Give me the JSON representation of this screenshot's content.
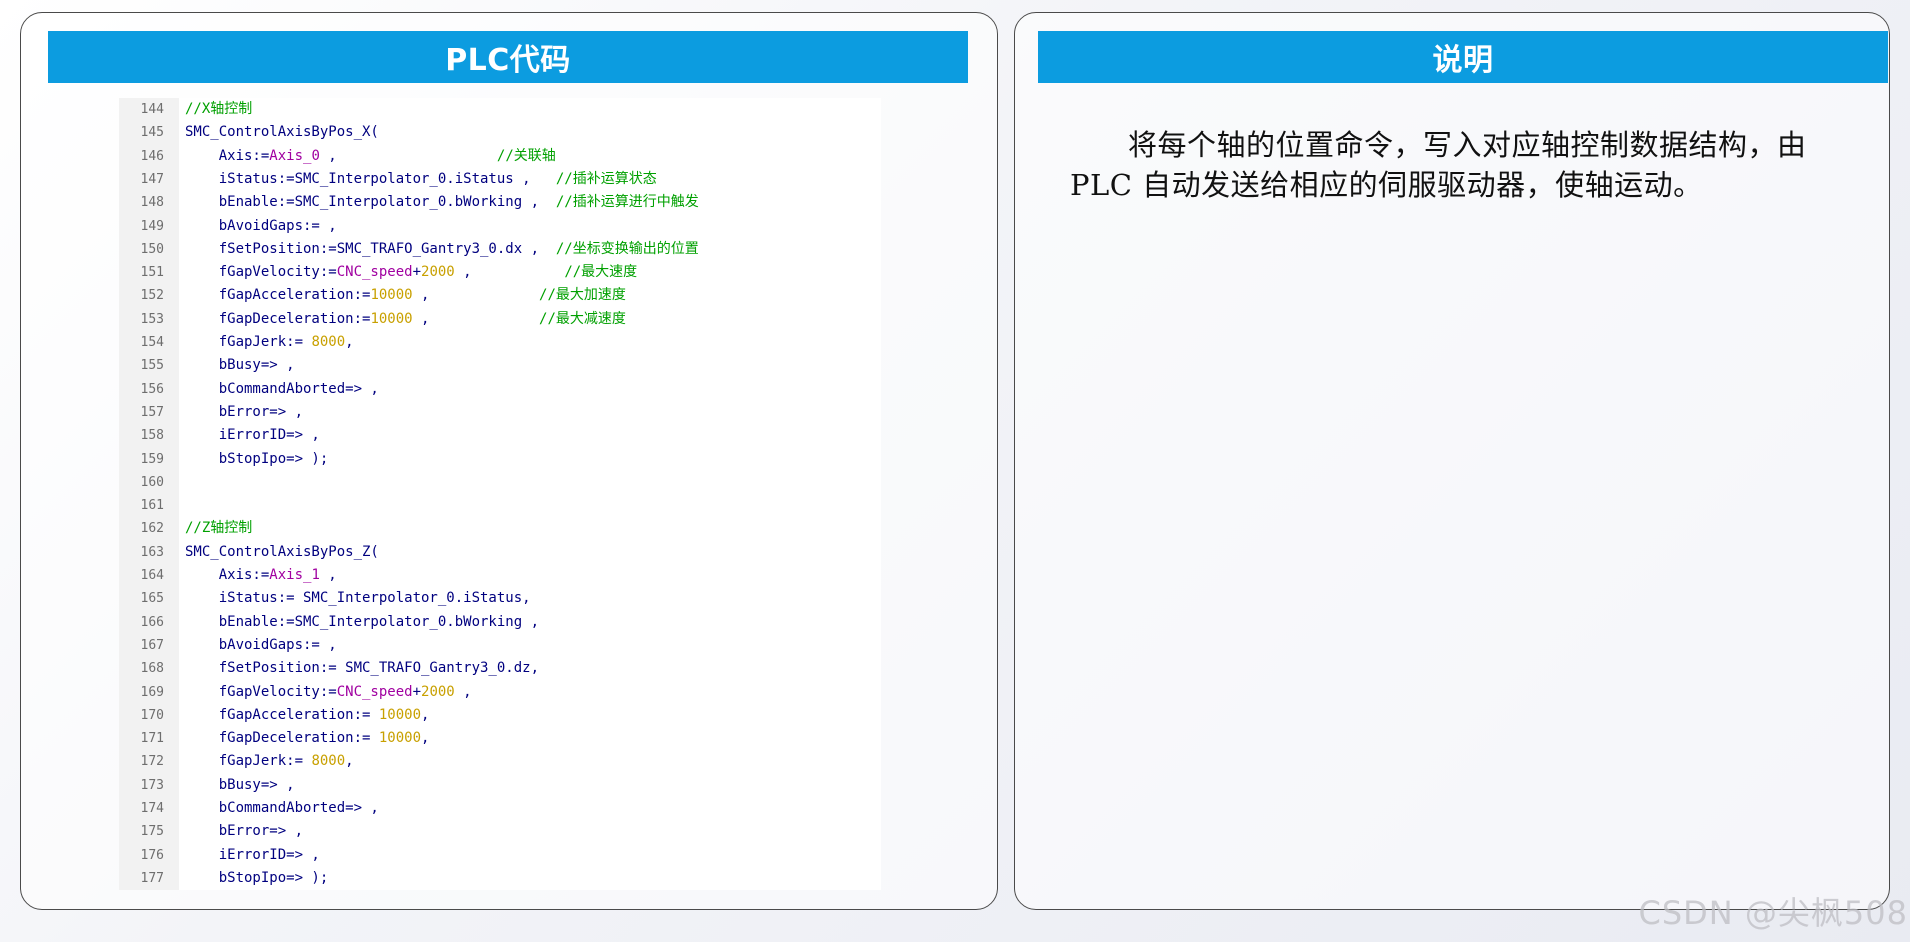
{
  "left_panel": {
    "title": "PLC代码",
    "code_lines": [
      {
        "num": "144",
        "parts": [
          {
            "t": "//X轴控制",
            "c": "green"
          }
        ]
      },
      {
        "num": "145",
        "parts": [
          {
            "t": "SMC_ControlAxisByPos_X(",
            "c": "blue"
          }
        ]
      },
      {
        "num": "146",
        "parts": [
          {
            "t": "    Axis:=",
            "c": "blue"
          },
          {
            "t": "Axis_0",
            "c": "purple"
          },
          {
            "t": " ,                   ",
            "c": "blue"
          },
          {
            "t": "//关联轴",
            "c": "green"
          }
        ]
      },
      {
        "num": "147",
        "parts": [
          {
            "t": "    iStatus:=SMC_Interpolator_0.iStatus ,   ",
            "c": "blue"
          },
          {
            "t": "//插补运算状态",
            "c": "green"
          }
        ]
      },
      {
        "num": "148",
        "parts": [
          {
            "t": "    bEnable:=SMC_Interpolator_0.bWorking ,  ",
            "c": "blue"
          },
          {
            "t": "//插补运算进行中触发",
            "c": "green"
          }
        ]
      },
      {
        "num": "149",
        "parts": [
          {
            "t": "    bAvoidGaps:= ,",
            "c": "blue"
          }
        ]
      },
      {
        "num": "150",
        "parts": [
          {
            "t": "    fSetPosition:=SMC_TRAFO_Gantry3_0.dx ,  ",
            "c": "blue"
          },
          {
            "t": "//坐标变换输出的位置",
            "c": "green"
          }
        ]
      },
      {
        "num": "151",
        "parts": [
          {
            "t": "    fGapVelocity:=",
            "c": "blue"
          },
          {
            "t": "CNC_speed",
            "c": "purple"
          },
          {
            "t": "+",
            "c": "blue"
          },
          {
            "t": "2000",
            "c": "orange"
          },
          {
            "t": " ,           ",
            "c": "blue"
          },
          {
            "t": "//最大速度",
            "c": "green"
          }
        ]
      },
      {
        "num": "152",
        "parts": [
          {
            "t": "    fGapAcceleration:=",
            "c": "blue"
          },
          {
            "t": "10000",
            "c": "orange"
          },
          {
            "t": " ,             ",
            "c": "blue"
          },
          {
            "t": "//最大加速度",
            "c": "green"
          }
        ]
      },
      {
        "num": "153",
        "parts": [
          {
            "t": "    fGapDeceleration:=",
            "c": "blue"
          },
          {
            "t": "10000",
            "c": "orange"
          },
          {
            "t": " ,             ",
            "c": "blue"
          },
          {
            "t": "//最大减速度",
            "c": "green"
          }
        ]
      },
      {
        "num": "154",
        "parts": [
          {
            "t": "    fGapJerk:= ",
            "c": "blue"
          },
          {
            "t": "8000",
            "c": "orange"
          },
          {
            "t": ",",
            "c": "blue"
          }
        ]
      },
      {
        "num": "155",
        "parts": [
          {
            "t": "    bBusy=> ,",
            "c": "blue"
          }
        ]
      },
      {
        "num": "156",
        "parts": [
          {
            "t": "    bCommandAborted=> ,",
            "c": "blue"
          }
        ]
      },
      {
        "num": "157",
        "parts": [
          {
            "t": "    bError=> ,",
            "c": "blue"
          }
        ]
      },
      {
        "num": "158",
        "parts": [
          {
            "t": "    iErrorID=> ,",
            "c": "blue"
          }
        ]
      },
      {
        "num": "159",
        "parts": [
          {
            "t": "    bStopIpo=> );",
            "c": "blue"
          }
        ]
      },
      {
        "num": "160",
        "parts": []
      },
      {
        "num": "161",
        "parts": []
      },
      {
        "num": "162",
        "parts": [
          {
            "t": "//Z轴控制",
            "c": "green"
          }
        ]
      },
      {
        "num": "163",
        "parts": [
          {
            "t": "SMC_ControlAxisByPos_Z(",
            "c": "blue"
          }
        ]
      },
      {
        "num": "164",
        "parts": [
          {
            "t": "    Axis:=",
            "c": "blue"
          },
          {
            "t": "Axis_1",
            "c": "purple"
          },
          {
            "t": " ,",
            "c": "blue"
          }
        ]
      },
      {
        "num": "165",
        "parts": [
          {
            "t": "    iStatus:= SMC_Interpolator_0.iStatus,",
            "c": "blue"
          }
        ]
      },
      {
        "num": "166",
        "parts": [
          {
            "t": "    bEnable:=SMC_Interpolator_0.bWorking ,",
            "c": "blue"
          }
        ]
      },
      {
        "num": "167",
        "parts": [
          {
            "t": "    bAvoidGaps:= ,",
            "c": "blue"
          }
        ]
      },
      {
        "num": "168",
        "parts": [
          {
            "t": "    fSetPosition:= SMC_TRAFO_Gantry3_0.dz,",
            "c": "blue"
          }
        ]
      },
      {
        "num": "169",
        "parts": [
          {
            "t": "    fGapVelocity:=",
            "c": "blue"
          },
          {
            "t": "CNC_speed",
            "c": "purple"
          },
          {
            "t": "+",
            "c": "blue"
          },
          {
            "t": "2000",
            "c": "orange"
          },
          {
            "t": " ,",
            "c": "blue"
          }
        ]
      },
      {
        "num": "170",
        "parts": [
          {
            "t": "    fGapAcceleration:= ",
            "c": "blue"
          },
          {
            "t": "10000",
            "c": "orange"
          },
          {
            "t": ",",
            "c": "blue"
          }
        ]
      },
      {
        "num": "171",
        "parts": [
          {
            "t": "    fGapDeceleration:= ",
            "c": "blue"
          },
          {
            "t": "10000",
            "c": "orange"
          },
          {
            "t": ",",
            "c": "blue"
          }
        ]
      },
      {
        "num": "172",
        "parts": [
          {
            "t": "    fGapJerk:= ",
            "c": "blue"
          },
          {
            "t": "8000",
            "c": "orange"
          },
          {
            "t": ",",
            "c": "blue"
          }
        ]
      },
      {
        "num": "173",
        "parts": [
          {
            "t": "    bBusy=> ,",
            "c": "blue"
          }
        ]
      },
      {
        "num": "174",
        "parts": [
          {
            "t": "    bCommandAborted=> ,",
            "c": "blue"
          }
        ]
      },
      {
        "num": "175",
        "parts": [
          {
            "t": "    bError=> ,",
            "c": "blue"
          }
        ]
      },
      {
        "num": "176",
        "parts": [
          {
            "t": "    iErrorID=> ,",
            "c": "blue"
          }
        ]
      },
      {
        "num": "177",
        "parts": [
          {
            "t": "    bStopIpo=> );",
            "c": "blue"
          }
        ]
      }
    ]
  },
  "right_panel": {
    "title": "说明",
    "description": "将每个轴的位置命令，写入对应轴控制数据结构，由 PLC 自动发送给相应的伺服驱动器，使轴运动。"
  },
  "watermark": "CSDN @尖枫508",
  "colors": {
    "header_bg": "#0c9ce0",
    "code_default": "#00007f",
    "code_comment": "#00a000",
    "code_variable": "#a000a0",
    "code_number": "#c8a000"
  }
}
